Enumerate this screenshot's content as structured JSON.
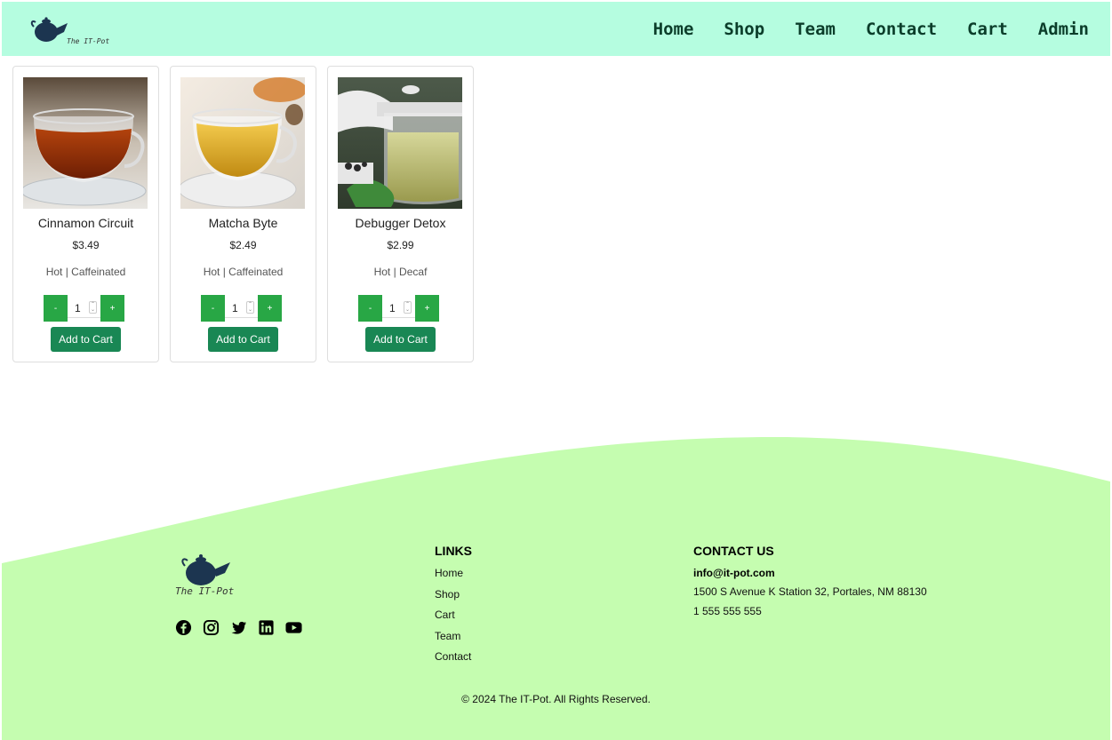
{
  "brand": {
    "name": "The IT-Pot"
  },
  "nav": {
    "items": [
      {
        "label": "Home"
      },
      {
        "label": "Shop"
      },
      {
        "label": "Team"
      },
      {
        "label": "Contact"
      },
      {
        "label": "Cart"
      },
      {
        "label": "Admin"
      }
    ]
  },
  "products": [
    {
      "name": "Cinnamon Circuit",
      "price": "$3.49",
      "tags": "Hot | Caffeinated",
      "qty": "1",
      "minus": "-",
      "plus": "+",
      "add_label": "Add to Cart"
    },
    {
      "name": "Matcha Byte",
      "price": "$2.49",
      "tags": "Hot | Caffeinated",
      "qty": "1",
      "minus": "-",
      "plus": "+",
      "add_label": "Add to Cart"
    },
    {
      "name": "Debugger Detox",
      "price": "$2.99",
      "tags": "Hot | Decaf",
      "qty": "1",
      "minus": "-",
      "plus": "+",
      "add_label": "Add to Cart"
    }
  ],
  "footer": {
    "brand": "The IT-Pot",
    "links_heading": "LINKS",
    "links": [
      "Home",
      "Shop",
      "Cart",
      "Team",
      "Contact"
    ],
    "contact_heading": "CONTACT US",
    "email": "info@it-pot.com",
    "address": "1500 S Avenue K Station 32, Portales, NM 88130",
    "phone": "1 555 555 555",
    "social": [
      "facebook-icon",
      "instagram-icon",
      "twitter-icon",
      "linkedin-icon",
      "youtube-icon"
    ],
    "copyright": "© 2024 The IT-Pot. All Rights Reserved."
  },
  "colors": {
    "navbar_bg": "#b5fde0",
    "footer_bg": "#c5fdb0",
    "qty_button": "#28a745",
    "add_button": "#198754"
  }
}
